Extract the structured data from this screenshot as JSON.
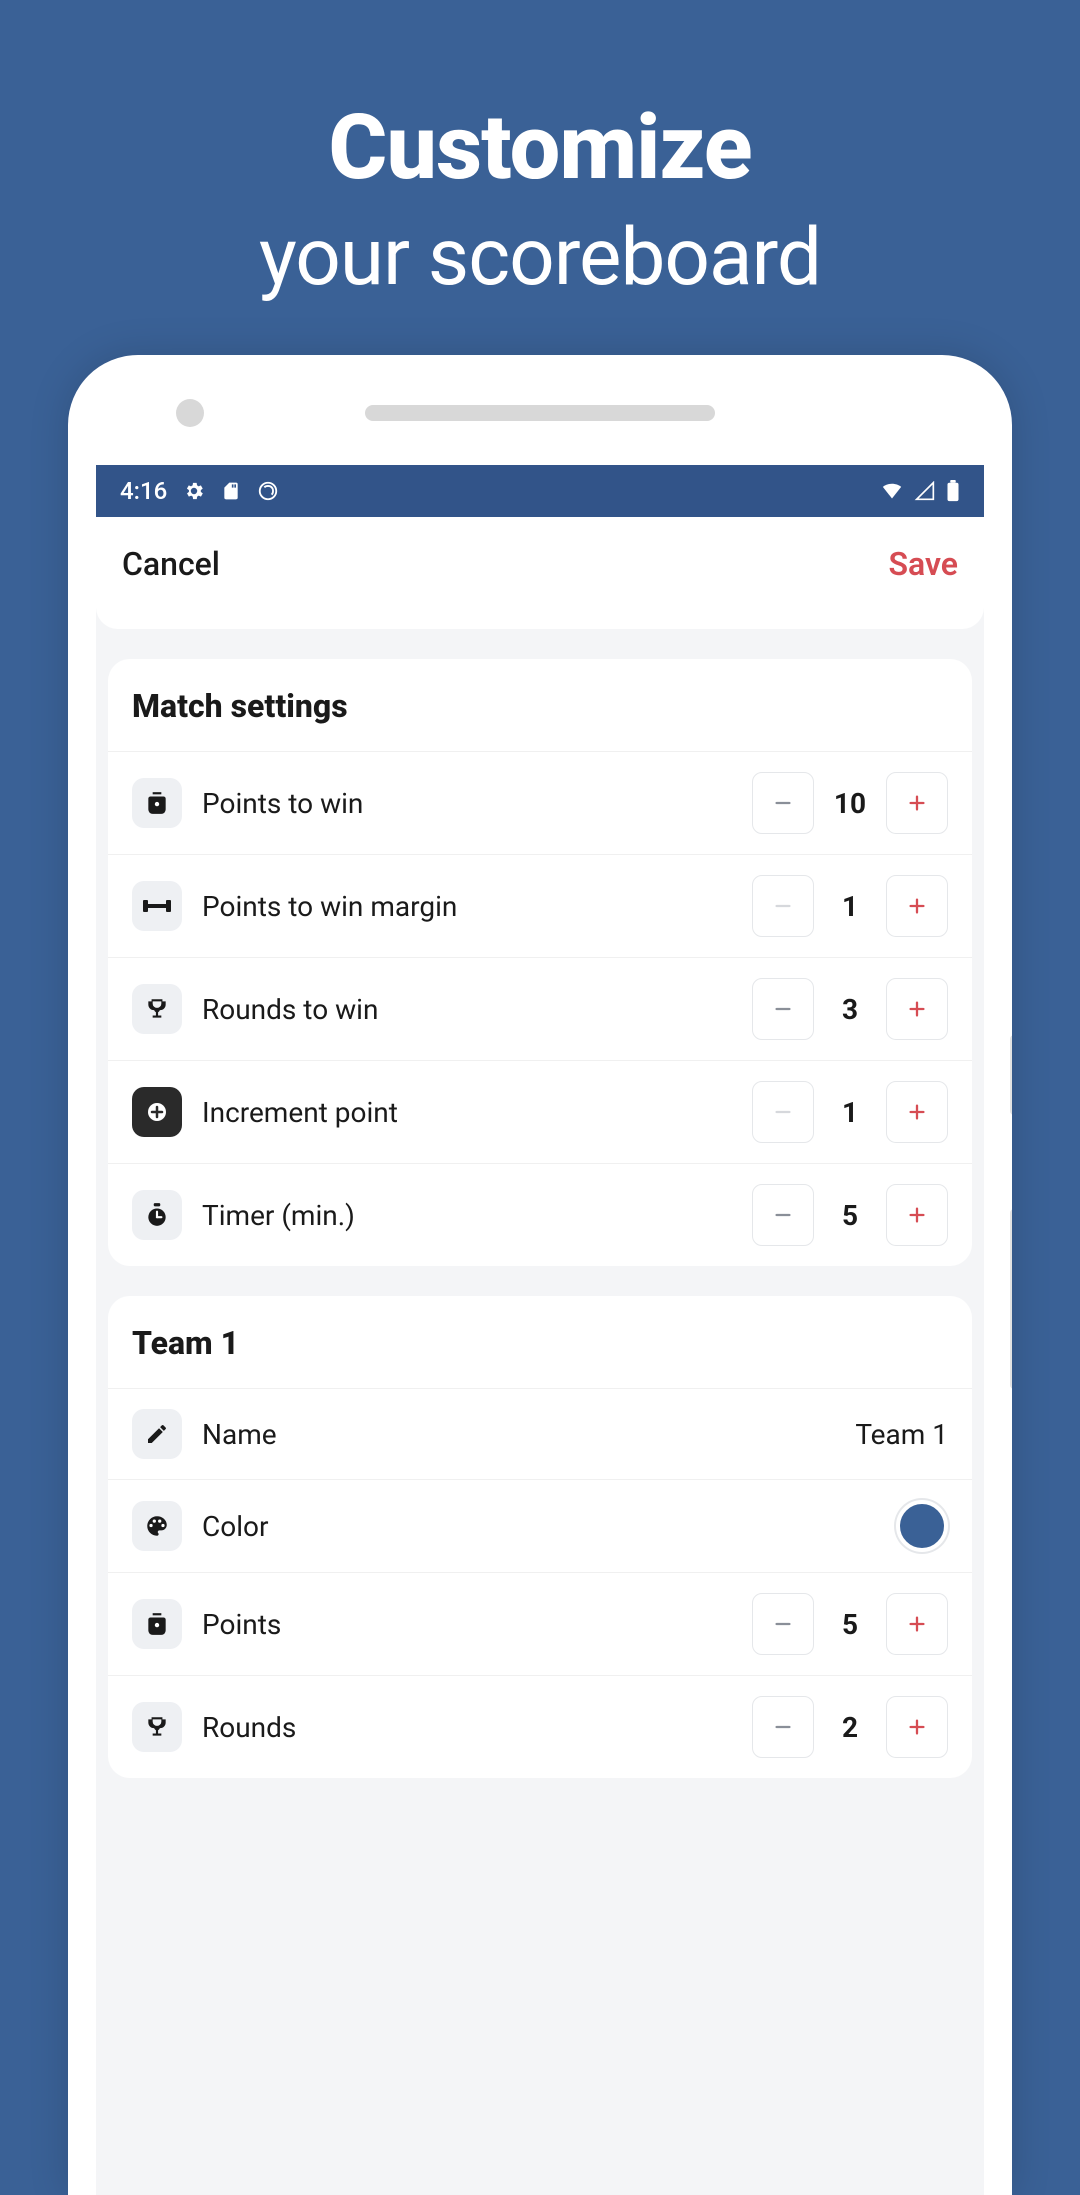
{
  "promo": {
    "title": "Customize",
    "subtitle": "your scoreboard"
  },
  "statusBar": {
    "time": "4:16"
  },
  "header": {
    "cancel": "Cancel",
    "save": "Save"
  },
  "matchSettings": {
    "title": "Match settings",
    "rows": [
      {
        "label": "Points to win",
        "value": "10",
        "minusEnabled": true
      },
      {
        "label": "Points to win margin",
        "value": "1",
        "minusEnabled": false
      },
      {
        "label": "Rounds to win",
        "value": "3",
        "minusEnabled": true
      },
      {
        "label": "Increment point",
        "value": "1",
        "minusEnabled": false
      },
      {
        "label": "Timer (min.)",
        "value": "5",
        "minusEnabled": true
      }
    ]
  },
  "team1": {
    "title": "Team 1",
    "nameLabel": "Name",
    "nameValue": "Team 1",
    "colorLabel": "Color",
    "colorValue": "#3a6196",
    "pointsLabel": "Points",
    "pointsValue": "5",
    "roundsLabel": "Rounds",
    "roundsValue": "2"
  }
}
